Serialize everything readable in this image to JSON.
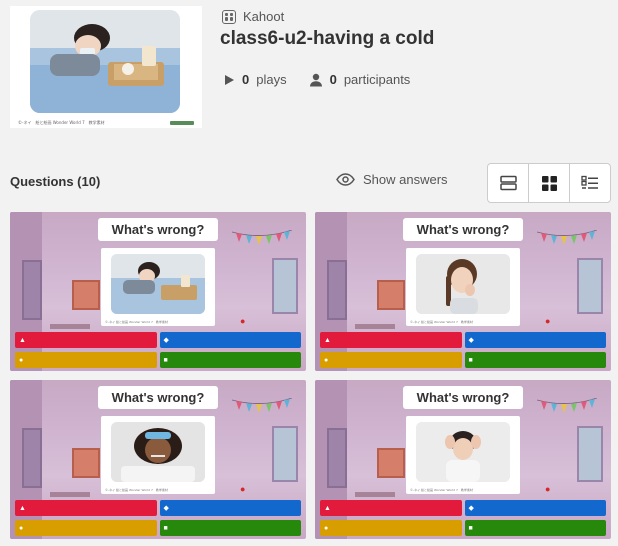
{
  "brand": {
    "label": "Kahoot",
    "icon": "kahoot-grid-icon"
  },
  "kahoot": {
    "title": "class6-u2-having a cold",
    "cover_caption": "©-ネイ　絵と絵画 Wonder World 7　教学素材",
    "plays_count": "0",
    "plays_label": "plays",
    "participants_count": "0",
    "participants_label": "participants"
  },
  "questions": {
    "heading": "Questions (10)",
    "show_answers_label": "Show answers",
    "view_modes": [
      "list-view-icon",
      "grid-view-icon",
      "detail-list-icon"
    ],
    "active_view": "grid-view-icon",
    "items": [
      {
        "text": "What's wrong?",
        "image": "child sleeping in bed with drink tray",
        "caption": "©-ネイ 絵と絵画 Wonder World 7　教学素材"
      },
      {
        "text": "What's wrong?",
        "image": "girl coughing into hand",
        "caption": "©-ネイ 絵と絵画 Wonder World 7　教学素材"
      },
      {
        "text": "What's wrong?",
        "image": "girl lying with thermometer and ice pack",
        "caption": "©-ネイ 絵と絵画 Wonder World 7　教学素材"
      },
      {
        "text": "What's wrong?",
        "image": "boy holding head with headache",
        "caption": "©-ネイ 絵と絵画 Wonder World 7　教学素材"
      }
    ],
    "answer_colors": {
      "red": "#e21b3c",
      "blue": "#1368ce",
      "yellow": "#d89e00",
      "green": "#26890c"
    },
    "answer_symbols": [
      "▲",
      "◆",
      "●",
      "■"
    ]
  }
}
